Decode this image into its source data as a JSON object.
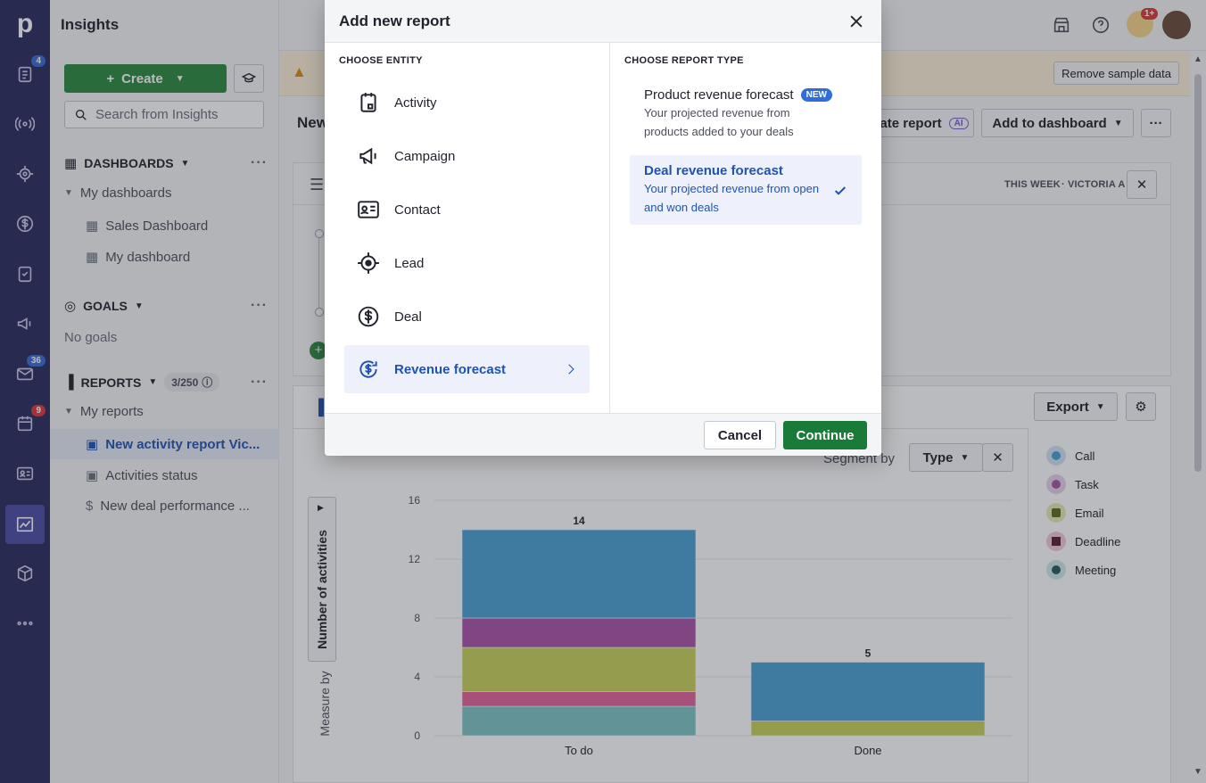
{
  "sidebar": {
    "title": "Insights",
    "create_label": "Create",
    "search_placeholder": "Search from Insights",
    "dashboards_label": "DASHBOARDS",
    "my_dashboards_label": "My dashboards",
    "dashboards": [
      "Sales Dashboard",
      "My dashboard"
    ],
    "goals_label": "GOALS",
    "no_goals": "No goals",
    "reports_label": "REPORTS",
    "reports_counter": "3/250",
    "my_reports_label": "My reports",
    "reports": [
      "New activity report Vic...",
      "Activities status",
      "New deal performance ..."
    ]
  },
  "rail": {
    "badges": {
      "activities": "4",
      "mail": "36",
      "calendar": "9"
    }
  },
  "topbar": {
    "bulb_badge": "1+"
  },
  "banner": {
    "remove_label": "Remove sample data"
  },
  "main": {
    "title_partial": "New",
    "create_report_label": "ate report",
    "ai_label": "AI",
    "add_dashboard_label": "Add to dashboard",
    "period_label": "THIS WEEK",
    "owner_label": "VICTORIA A",
    "export_label": "Export",
    "segment_by_label": "Segment by",
    "segment_value": "Type",
    "measure_by_label": "Measure by",
    "measure_value": "Number of activities"
  },
  "modal": {
    "title": "Add new report",
    "entity_header": "CHOOSE ENTITY",
    "type_header": "CHOOSE REPORT TYPE",
    "entities": [
      "Activity",
      "Campaign",
      "Contact",
      "Lead",
      "Deal",
      "Revenue forecast"
    ],
    "selected_entity": "Revenue forecast",
    "report_types": [
      {
        "title": "Product revenue forecast",
        "badge": "NEW",
        "desc": "Your projected revenue from products added to your deals"
      },
      {
        "title": "Deal revenue forecast",
        "desc": "Your projected revenue from open and won deals",
        "selected": true
      }
    ],
    "cancel_label": "Cancel",
    "continue_label": "Continue"
  },
  "chart_data": {
    "type": "bar",
    "stacked": true,
    "categories": [
      "To do",
      "Done"
    ],
    "totals": [
      14,
      5
    ],
    "ylim": [
      0,
      16
    ],
    "yticks": [
      0,
      4,
      8,
      12,
      16
    ],
    "ylabel": "Number of activities",
    "grid": true,
    "legend_position": "right",
    "series": [
      {
        "name": "Meeting",
        "color": "#7cc4c6",
        "values": [
          2,
          0
        ]
      },
      {
        "name": "Deadline",
        "color": "#e0649a",
        "values": [
          1,
          0
        ]
      },
      {
        "name": "Email",
        "color": "#c9d25a",
        "values": [
          3,
          1
        ]
      },
      {
        "name": "Task",
        "color": "#a953a9",
        "values": [
          2,
          0
        ]
      },
      {
        "name": "Call",
        "color": "#4a9fd4",
        "values": [
          6,
          4
        ]
      }
    ],
    "legend": [
      "Call",
      "Task",
      "Email",
      "Deadline",
      "Meeting"
    ]
  }
}
